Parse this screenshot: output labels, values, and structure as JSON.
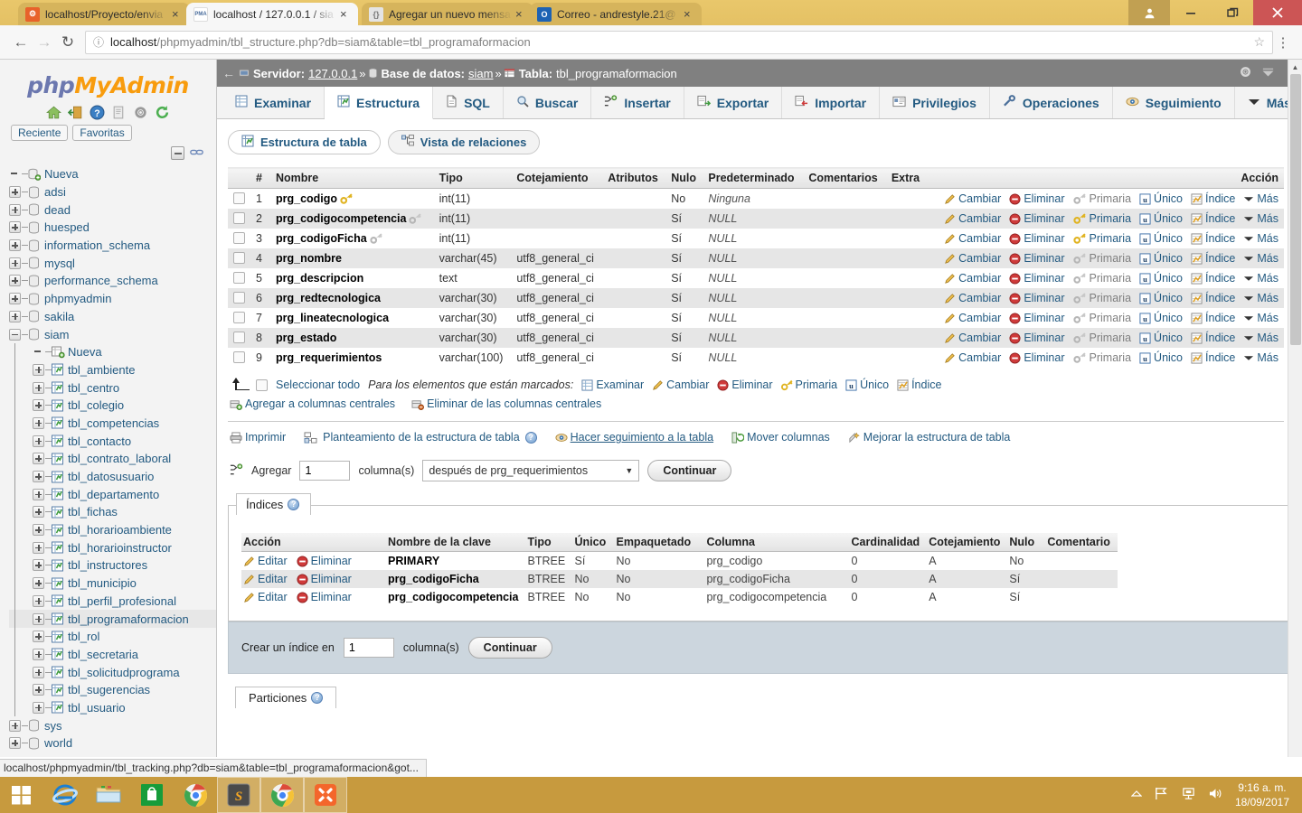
{
  "browser": {
    "tabs": [
      {
        "title": "localhost/Proyecto/envia",
        "favicon_color": "#e8622a",
        "favicon_glyph": "⌘",
        "active": false
      },
      {
        "title": "localhost / 127.0.0.1 / sia",
        "favicon_color": "#f7f7f7",
        "favicon_glyph": "PMA",
        "active": true
      },
      {
        "title": "Agregar un nuevo mensa",
        "favicon_color": "#cfcfcf",
        "favicon_glyph": "{}",
        "active": false
      },
      {
        "title": "Correo - andrestyle.21@",
        "favicon_color": "#1d62b3",
        "favicon_glyph": "O",
        "active": false
      }
    ],
    "close_label": "×",
    "window_controls": {
      "user": "♟",
      "minimize": "–",
      "restore": "❐",
      "close": "✕"
    },
    "nav": {
      "back": "←",
      "forward": "→",
      "reload": "↻",
      "menu": "⋮"
    },
    "url_host": "localhost",
    "url_path": "/phpmyadmin/tbl_structure.php?db=siam&table=tbl_programaformacion",
    "info_icon": "ⓘ",
    "star_icon": "☆",
    "status_text": "localhost/phpmyadmin/tbl_tracking.php?db=siam&table=tbl_programaformacion&got..."
  },
  "navpanel": {
    "logo_php": "php",
    "logo_my": "MyAdmin",
    "icons": [
      "home-icon",
      "logout-icon",
      "docs-icon",
      "pma-docs-icon",
      "settings-icon",
      "reload-icon"
    ],
    "chips": [
      "Reciente",
      "Favoritas"
    ],
    "collapse_label": "collapse-all",
    "link_label": "link-with-main-panel",
    "tree": [
      {
        "label": "Nueva",
        "level": 0,
        "toggle": "none",
        "icon": "new-db-icon",
        "selected": false
      },
      {
        "label": "adsi",
        "level": 0,
        "toggle": "plus",
        "icon": "db-icon",
        "selected": false
      },
      {
        "label": "dead",
        "level": 0,
        "toggle": "plus",
        "icon": "db-icon",
        "selected": false
      },
      {
        "label": "huesped",
        "level": 0,
        "toggle": "plus",
        "icon": "db-icon",
        "selected": false
      },
      {
        "label": "information_schema",
        "level": 0,
        "toggle": "plus",
        "icon": "db-icon",
        "selected": false
      },
      {
        "label": "mysql",
        "level": 0,
        "toggle": "plus",
        "icon": "db-icon",
        "selected": false
      },
      {
        "label": "performance_schema",
        "level": 0,
        "toggle": "plus",
        "icon": "db-icon",
        "selected": false
      },
      {
        "label": "phpmyadmin",
        "level": 0,
        "toggle": "plus",
        "icon": "db-icon",
        "selected": false
      },
      {
        "label": "sakila",
        "level": 0,
        "toggle": "plus",
        "icon": "db-icon",
        "selected": false
      },
      {
        "label": "siam",
        "level": 0,
        "toggle": "minus",
        "icon": "db-icon",
        "selected": false
      },
      {
        "label": "Nueva",
        "level": 1,
        "toggle": "none",
        "icon": "new-table-icon",
        "selected": false
      },
      {
        "label": "tbl_ambiente",
        "level": 1,
        "toggle": "plus",
        "icon": "table-icon",
        "selected": false
      },
      {
        "label": "tbl_centro",
        "level": 1,
        "toggle": "plus",
        "icon": "table-icon",
        "selected": false
      },
      {
        "label": "tbl_colegio",
        "level": 1,
        "toggle": "plus",
        "icon": "table-icon",
        "selected": false
      },
      {
        "label": "tbl_competencias",
        "level": 1,
        "toggle": "plus",
        "icon": "table-icon",
        "selected": false
      },
      {
        "label": "tbl_contacto",
        "level": 1,
        "toggle": "plus",
        "icon": "table-icon",
        "selected": false
      },
      {
        "label": "tbl_contrato_laboral",
        "level": 1,
        "toggle": "plus",
        "icon": "table-icon",
        "selected": false
      },
      {
        "label": "tbl_datosusuario",
        "level": 1,
        "toggle": "plus",
        "icon": "table-icon",
        "selected": false
      },
      {
        "label": "tbl_departamento",
        "level": 1,
        "toggle": "plus",
        "icon": "table-icon",
        "selected": false
      },
      {
        "label": "tbl_fichas",
        "level": 1,
        "toggle": "plus",
        "icon": "table-icon",
        "selected": false
      },
      {
        "label": "tbl_horarioambiente",
        "level": 1,
        "toggle": "plus",
        "icon": "table-icon",
        "selected": false
      },
      {
        "label": "tbl_horarioinstructor",
        "level": 1,
        "toggle": "plus",
        "icon": "table-icon",
        "selected": false
      },
      {
        "label": "tbl_instructores",
        "level": 1,
        "toggle": "plus",
        "icon": "table-icon",
        "selected": false
      },
      {
        "label": "tbl_municipio",
        "level": 1,
        "toggle": "plus",
        "icon": "table-icon",
        "selected": false
      },
      {
        "label": "tbl_perfil_profesional",
        "level": 1,
        "toggle": "plus",
        "icon": "table-icon",
        "selected": false
      },
      {
        "label": "tbl_programaformacion",
        "level": 1,
        "toggle": "plus",
        "icon": "table-icon",
        "selected": true
      },
      {
        "label": "tbl_rol",
        "level": 1,
        "toggle": "plus",
        "icon": "table-icon",
        "selected": false
      },
      {
        "label": "tbl_secretaria",
        "level": 1,
        "toggle": "plus",
        "icon": "table-icon",
        "selected": false
      },
      {
        "label": "tbl_solicitudprograma",
        "level": 1,
        "toggle": "plus",
        "icon": "table-icon",
        "selected": false
      },
      {
        "label": "tbl_sugerencias",
        "level": 1,
        "toggle": "plus",
        "icon": "table-icon",
        "selected": false
      },
      {
        "label": "tbl_usuario",
        "level": 1,
        "toggle": "plus",
        "icon": "table-icon",
        "selected": false
      },
      {
        "label": "sys",
        "level": 0,
        "toggle": "plus",
        "icon": "db-icon",
        "selected": false
      },
      {
        "label": "world",
        "level": 0,
        "toggle": "plus",
        "icon": "db-icon",
        "selected": false
      }
    ]
  },
  "breadcrumb": {
    "back_arrow": "←",
    "server_label": "Servidor:",
    "server_value": "127.0.0.1",
    "db_label": "Base de datos:",
    "db_value": "siam",
    "table_label": "Tabla:",
    "table_value": "tbl_programaformacion",
    "sep": "»",
    "settings_icon": "⚙",
    "collapse_icon": "⤒"
  },
  "main_tabs": [
    {
      "label": "Examinar",
      "icon": "browse-icon",
      "active": false
    },
    {
      "label": "Estructura",
      "icon": "structure-icon",
      "active": true
    },
    {
      "label": "SQL",
      "icon": "sql-icon",
      "active": false
    },
    {
      "label": "Buscar",
      "icon": "search-icon",
      "active": false
    },
    {
      "label": "Insertar",
      "icon": "insert-icon",
      "active": false
    },
    {
      "label": "Exportar",
      "icon": "export-icon",
      "active": false
    },
    {
      "label": "Importar",
      "icon": "import-icon",
      "active": false
    },
    {
      "label": "Privilegios",
      "icon": "privileges-icon",
      "active": false
    },
    {
      "label": "Operaciones",
      "icon": "operations-icon",
      "active": false
    },
    {
      "label": "Seguimiento",
      "icon": "tracking-icon",
      "active": false
    },
    {
      "label": "Más",
      "icon": "chevron-down-icon",
      "active": false
    }
  ],
  "sub_tabs": [
    {
      "label": "Estructura de tabla",
      "icon": "structure-icon",
      "active": true
    },
    {
      "label": "Vista de relaciones",
      "icon": "relation-icon",
      "active": false
    }
  ],
  "structure_table": {
    "headers": [
      "",
      "#",
      "Nombre",
      "Tipo",
      "Cotejamiento",
      "Atributos",
      "Nulo",
      "Predeterminado",
      "Comentarios",
      "Extra",
      "Acción"
    ],
    "rows": [
      {
        "num": "1",
        "name": "prg_codigo",
        "key": "primary",
        "type": "int(11)",
        "collation": "",
        "attributes": "",
        "null": "No",
        "default": "Ninguna",
        "comments": "",
        "extra": ""
      },
      {
        "num": "2",
        "name": "prg_codigocompetencia",
        "key": "index",
        "type": "int(11)",
        "collation": "",
        "attributes": "",
        "null": "Sí",
        "default": "NULL",
        "comments": "",
        "extra": ""
      },
      {
        "num": "3",
        "name": "prg_codigoFicha",
        "key": "index",
        "type": "int(11)",
        "collation": "",
        "attributes": "",
        "null": "Sí",
        "default": "NULL",
        "comments": "",
        "extra": ""
      },
      {
        "num": "4",
        "name": "prg_nombre",
        "key": "none",
        "type": "varchar(45)",
        "collation": "utf8_general_ci",
        "attributes": "",
        "null": "Sí",
        "default": "NULL",
        "comments": "",
        "extra": ""
      },
      {
        "num": "5",
        "name": "prg_descripcion",
        "key": "none",
        "type": "text",
        "collation": "utf8_general_ci",
        "attributes": "",
        "null": "Sí",
        "default": "NULL",
        "comments": "",
        "extra": ""
      },
      {
        "num": "6",
        "name": "prg_redtecnologica",
        "key": "none",
        "type": "varchar(30)",
        "collation": "utf8_general_ci",
        "attributes": "",
        "null": "Sí",
        "default": "NULL",
        "comments": "",
        "extra": ""
      },
      {
        "num": "7",
        "name": "prg_lineatecnologica",
        "key": "none",
        "type": "varchar(30)",
        "collation": "utf8_general_ci",
        "attributes": "",
        "null": "Sí",
        "default": "NULL",
        "comments": "",
        "extra": ""
      },
      {
        "num": "8",
        "name": "prg_estado",
        "key": "none",
        "type": "varchar(30)",
        "collation": "utf8_general_ci",
        "attributes": "",
        "null": "Sí",
        "default": "NULL",
        "comments": "",
        "extra": ""
      },
      {
        "num": "9",
        "name": "prg_requerimientos",
        "key": "none",
        "type": "varchar(100)",
        "collation": "utf8_general_ci",
        "attributes": "",
        "null": "Sí",
        "default": "NULL",
        "comments": "",
        "extra": ""
      }
    ],
    "row_actions": [
      "Cambiar",
      "Eliminar",
      "Primaria",
      "Único",
      "Índice",
      "Más"
    ]
  },
  "bulk_actions": {
    "select_all": "Seleccionar todo",
    "marked_label": "Para los elementos que están marcados:",
    "actions": [
      "Examinar",
      "Cambiar",
      "Eliminar",
      "Primaria",
      "Único",
      "Índice"
    ],
    "add_central": "Agregar a columnas centrales",
    "remove_central": "Eliminar de las columnas centrales"
  },
  "tools": [
    {
      "label": "Imprimir",
      "icon": "print-icon",
      "underline": false
    },
    {
      "label": "Planteamiento de la estructura de tabla",
      "icon": "propose-icon",
      "underline": false
    },
    {
      "label": "Hacer seguimiento a la tabla",
      "icon": "tracking-icon",
      "underline": true
    },
    {
      "label": "Mover columnas",
      "icon": "move-columns-icon",
      "underline": false
    },
    {
      "label": "Mejorar la estructura de tabla",
      "icon": "normalize-icon",
      "underline": false
    }
  ],
  "add_column": {
    "label": "Agregar",
    "count": "1",
    "columns_label": "columna(s)",
    "position": "después de prg_requerimientos",
    "submit": "Continuar"
  },
  "indices": {
    "legend": "Índices",
    "headers": [
      "Acción",
      "Nombre de la clave",
      "Tipo",
      "Único",
      "Empaquetado",
      "Columna",
      "Cardinalidad",
      "Cotejamiento",
      "Nulo",
      "Comentario"
    ],
    "row_actions": [
      "Editar",
      "Eliminar"
    ],
    "rows": [
      {
        "key": "PRIMARY",
        "type": "BTREE",
        "unique": "Sí",
        "packed": "No",
        "column": "prg_codigo",
        "cardinality": "0",
        "collation": "A",
        "null": "No",
        "comment": ""
      },
      {
        "key": "prg_codigoFicha",
        "type": "BTREE",
        "unique": "No",
        "packed": "No",
        "column": "prg_codigoFicha",
        "cardinality": "0",
        "collation": "A",
        "null": "Sí",
        "comment": ""
      },
      {
        "key": "prg_codigocompetencia",
        "type": "BTREE",
        "unique": "No",
        "packed": "No",
        "column": "prg_codigocompetencia",
        "cardinality": "0",
        "collation": "A",
        "null": "Sí",
        "comment": ""
      }
    ]
  },
  "create_index": {
    "label": "Crear un índice en",
    "count": "1",
    "columns_label": "columna(s)",
    "submit": "Continuar"
  },
  "partitions": {
    "legend": "Particiones"
  },
  "taskbar": {
    "start": "start-button",
    "items": [
      {
        "name": "internet-explorer",
        "glyph": "e",
        "color": "#1a7fd4",
        "running": false
      },
      {
        "name": "file-explorer",
        "glyph": "▤",
        "color": "#f0c14b",
        "running": false
      },
      {
        "name": "windows-store",
        "glyph": "▣",
        "color": "#179c3a",
        "running": false
      },
      {
        "name": "google-chrome",
        "glyph": "◉",
        "color": "#dd4b39",
        "running": false
      },
      {
        "name": "sublime-text",
        "glyph": "S",
        "color": "#3a3a3a",
        "running": true
      },
      {
        "name": "google-chrome-active",
        "glyph": "◉",
        "color": "#dd4b39",
        "running": true
      },
      {
        "name": "xampp",
        "glyph": "✖",
        "color": "#f4662b",
        "running": true
      }
    ],
    "tray": [
      "show-hidden-icons",
      "network-flag-icon",
      "network-icon",
      "volume-icon"
    ],
    "clock_time": "9:16 a. m.",
    "clock_date": "18/09/2017"
  }
}
